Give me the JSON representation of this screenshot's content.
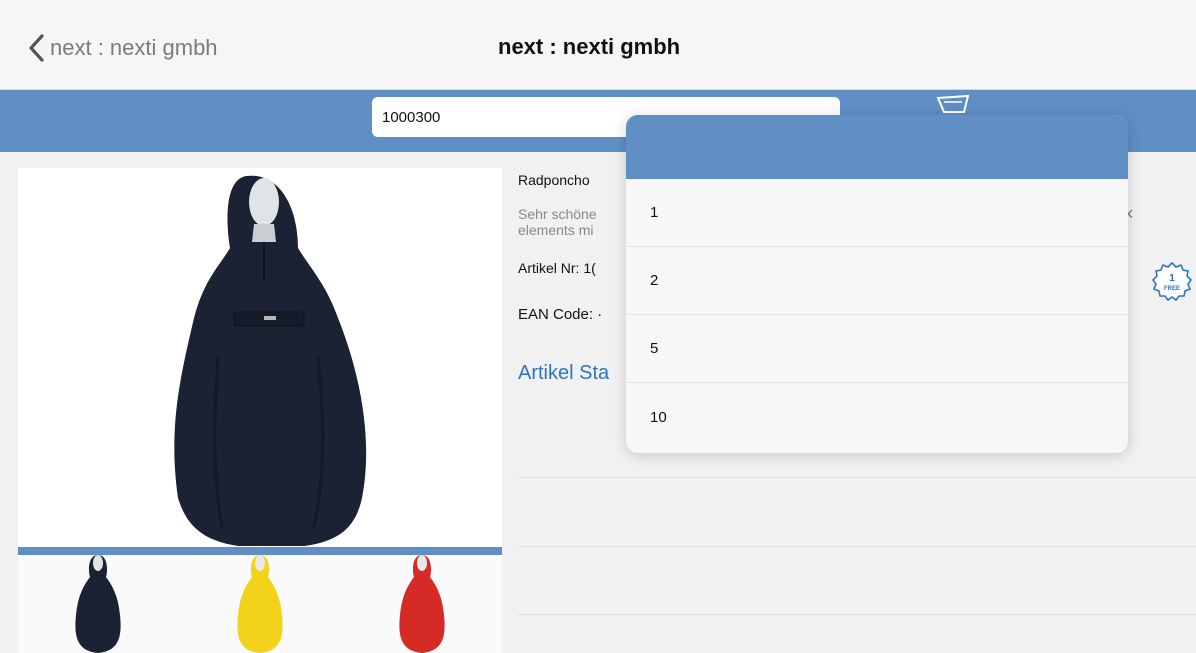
{
  "nav": {
    "back_label": "next : nexti gmbh",
    "title": "next : nexti gmbh"
  },
  "search": {
    "value": "1000300"
  },
  "product": {
    "name": "Radponcho",
    "description": "Sehr schöne elements mi",
    "article_nr": "Artikel Nr: 1(",
    "ean": "EAN Code: ·",
    "status_link": "Artikel Sta"
  },
  "badge": {
    "count": "1",
    "label": "FREE"
  },
  "quantity_options": [
    "1",
    "2",
    "5",
    "10"
  ],
  "close_glyph": "×",
  "colors": {
    "accent_blue": "#5f8fc4",
    "link_blue": "#2f74c0",
    "poncho_navy": "#1b2233",
    "poncho_yellow": "#f2d21a",
    "poncho_red": "#d52a26"
  }
}
